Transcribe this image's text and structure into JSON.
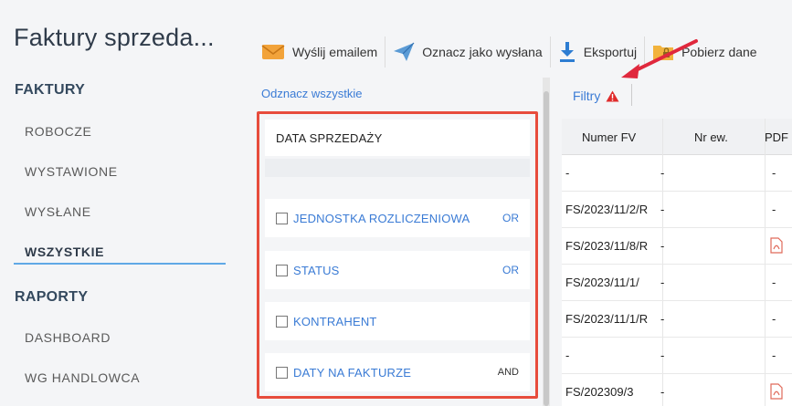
{
  "sidebar": {
    "title": "Faktury sprzeda...",
    "sections": [
      {
        "label": "FAKTURY",
        "items": [
          "ROBOCZE",
          "WYSTAWIONE",
          "WYSŁANE",
          "WSZYSTKIE"
        ]
      },
      {
        "label": "RAPORTY",
        "items": [
          "DASHBOARD",
          "WG HANDLOWCA"
        ]
      }
    ],
    "active_item": "WSZYSTKIE"
  },
  "toolbar": {
    "send_email": "Wyślij emailem",
    "mark_sent": "Oznacz jako wysłana",
    "export": "Eksportuj",
    "fetch": "Pobierz dane"
  },
  "filters": {
    "deselect_all": "Odznacz wszystkie",
    "header": "DATA SPRZEDAŻY",
    "items": [
      {
        "label": "JEDNOSTKA ROZLICZENIOWA",
        "op": "OR"
      },
      {
        "label": "STATUS",
        "op": "OR"
      },
      {
        "label": "KONTRAHENT",
        "op": ""
      },
      {
        "label": "DATY NA FAKTURZE",
        "op": "AND"
      }
    ],
    "filtry_label": "Filtry"
  },
  "table": {
    "headers": [
      "Numer FV",
      "Nr ew.",
      "PDF"
    ],
    "rows": [
      [
        "-",
        "-",
        "-"
      ],
      [
        "FS/2023/11/2/R",
        "-",
        "-"
      ],
      [
        "FS/2023/11/8/R",
        "-",
        "pdf"
      ],
      [
        "FS/2023/11/1/",
        "-",
        "-"
      ],
      [
        "FS/2023/11/1/R",
        "-",
        "-"
      ],
      [
        "-",
        "-",
        "-"
      ],
      [
        "FS/202309/3",
        "-",
        "pdf"
      ]
    ]
  },
  "colors": {
    "accent": "#3a7bd5",
    "highlight": "#e74c3c",
    "arrow": "#e0283d"
  }
}
